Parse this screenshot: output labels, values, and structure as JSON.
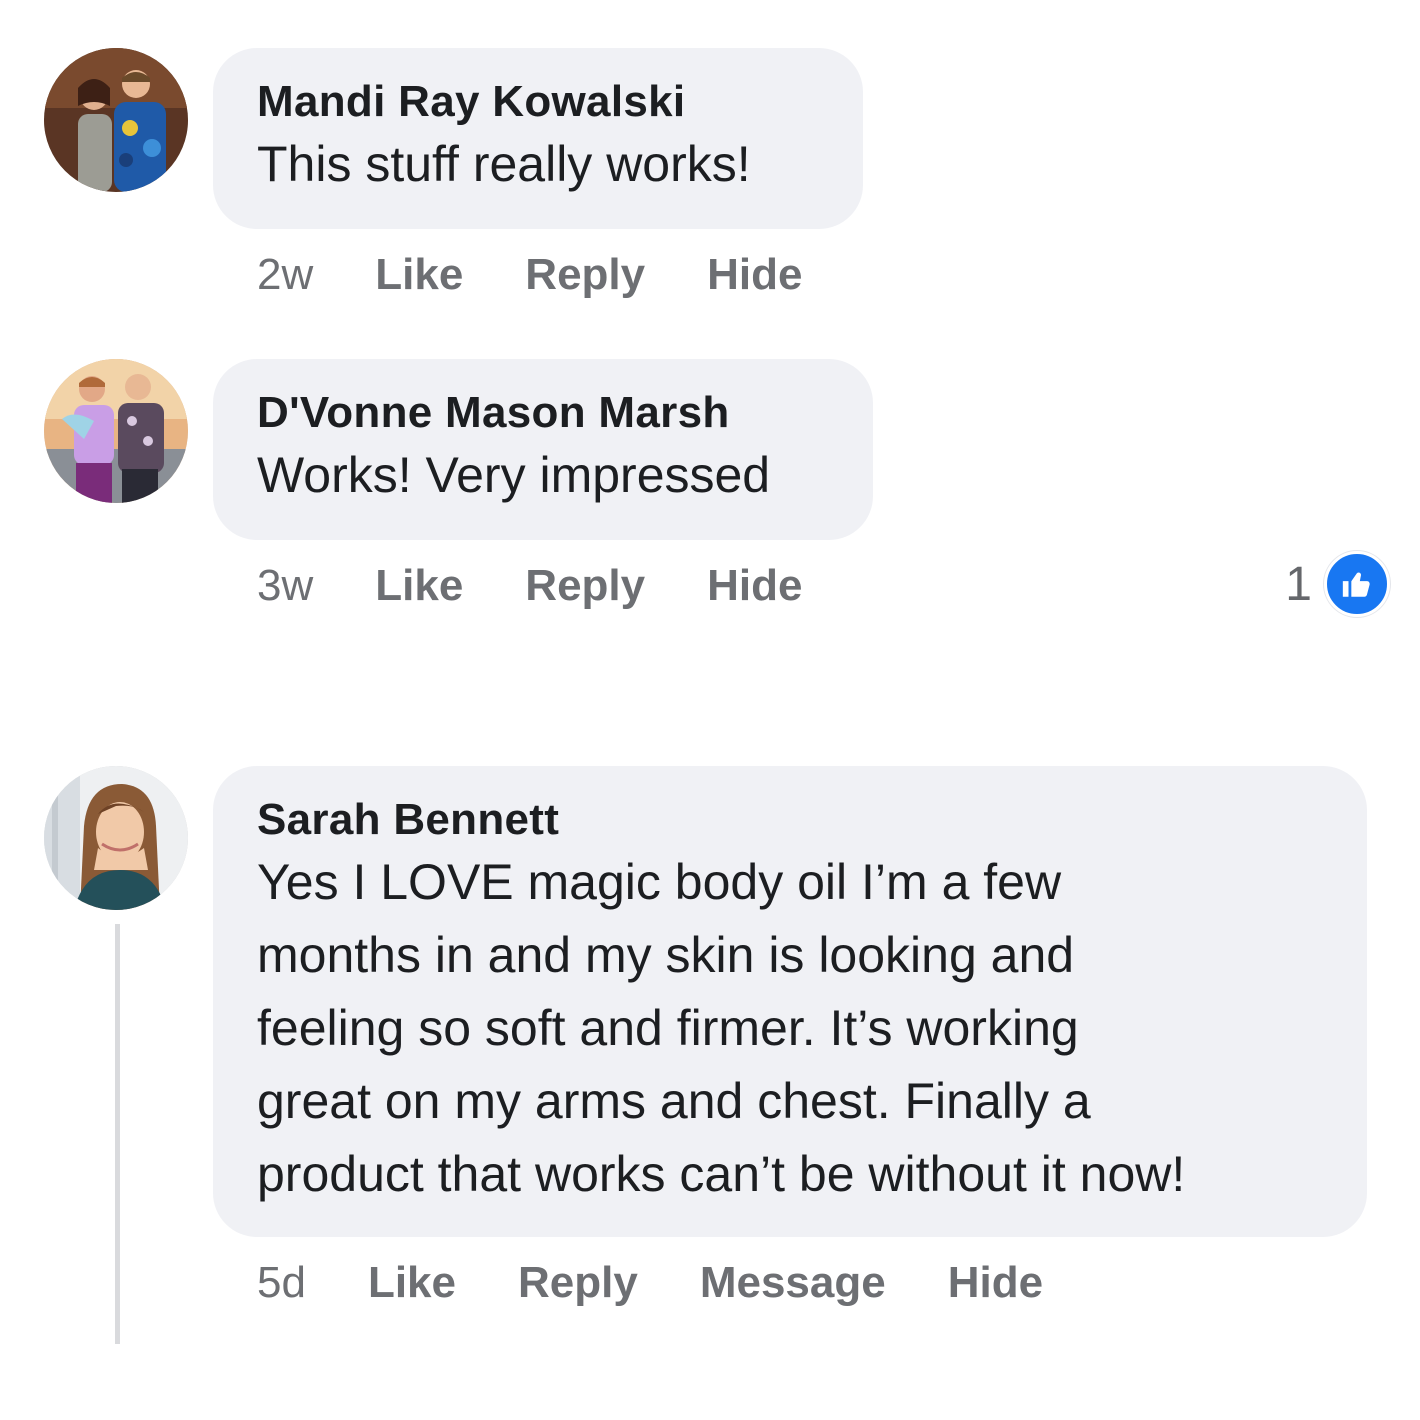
{
  "comments": [
    {
      "author": "Mandi Ray Kowalski",
      "lines": [
        "This stuff really works!"
      ],
      "time": "2w",
      "actions": [
        "Like",
        "Reply",
        "Hide"
      ]
    },
    {
      "author": "D'Vonne Mason Marsh",
      "lines": [
        "Works! Very impressed"
      ],
      "time": "3w",
      "actions": [
        "Like",
        "Reply",
        "Hide"
      ],
      "reaction_count": "1",
      "reaction_icon": "like-icon"
    },
    {
      "author": "Sarah Bennett",
      "lines": [
        "Yes I LOVE magic body oil I’m a few",
        "months in and my skin is looking and",
        "feeling so soft and firmer. It’s working",
        "great on my arms and chest. Finally a",
        "product that works can’t be without it now!"
      ],
      "time": "5d",
      "actions": [
        "Like",
        "Reply",
        "Message",
        "Hide"
      ]
    }
  ],
  "colors": {
    "bubble": "#f0f1f5",
    "action_text": "#6d6f73",
    "like_blue": "#1877f2",
    "thread_line": "#d9dadd"
  }
}
